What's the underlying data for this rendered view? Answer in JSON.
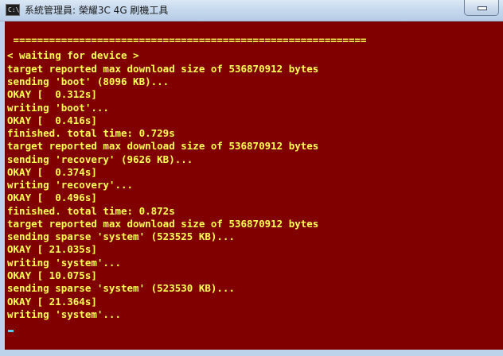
{
  "window": {
    "title": "系統管理員:  榮耀3C 4G 刷機工具",
    "icon": "cmd-icon",
    "icon_label": "C:\\"
  },
  "console": {
    "background_color": "#800000",
    "text_color": "#ffff55",
    "lines": [
      " ===========================================================",
      "< waiting for device >",
      "target reported max download size of 536870912 bytes",
      "sending 'boot' (8096 KB)...",
      "OKAY [  0.312s]",
      "writing 'boot'...",
      "OKAY [  0.416s]",
      "finished. total time: 0.729s",
      "target reported max download size of 536870912 bytes",
      "sending 'recovery' (9626 KB)...",
      "OKAY [  0.374s]",
      "writing 'recovery'...",
      "OKAY [  0.496s]",
      "finished. total time: 0.872s",
      "target reported max download size of 536870912 bytes",
      "sending sparse 'system' (523525 KB)...",
      "OKAY [ 21.035s]",
      "writing 'system'...",
      "OKAY [ 10.075s]",
      "sending sparse 'system' (523530 KB)...",
      "OKAY [ 21.364s]",
      "writing 'system'..."
    ]
  }
}
